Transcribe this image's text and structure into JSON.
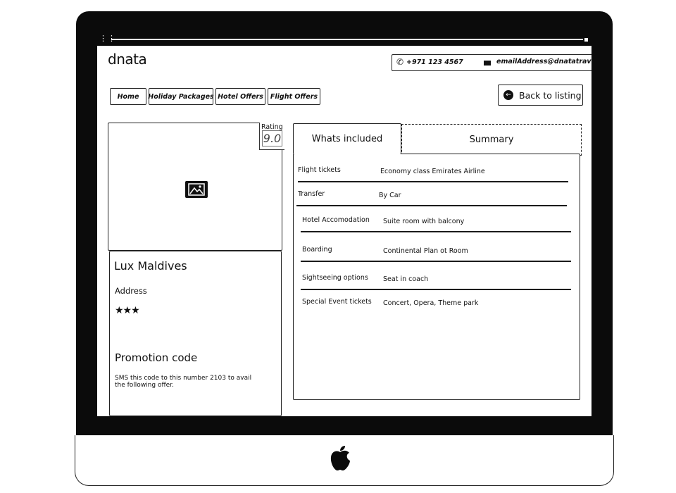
{
  "brand": {
    "logo": "dnata"
  },
  "contact": {
    "phone": "+971 123 4567",
    "email": "emailAddress@dnatatravel.com"
  },
  "nav": {
    "items": [
      {
        "label": "Home"
      },
      {
        "label": "Holiday Packages"
      },
      {
        "label": "Hotel Offers"
      },
      {
        "label": "Flight Offers"
      }
    ],
    "back_label": "Back to listing"
  },
  "hotel": {
    "rating_label": "Rating",
    "rating_value": "9.0",
    "name": "Lux Maldives",
    "address_label": "Address",
    "stars": "★★★",
    "star_count": 3
  },
  "promotion": {
    "title": "Promotion code",
    "text": "SMS this code to this number 2103 to avail the following offer."
  },
  "tabs": [
    {
      "label": "Whats included",
      "active": true
    },
    {
      "label": "Summary",
      "active": false
    }
  ],
  "included": [
    {
      "label": "Flight tickets",
      "value": "Economy class Emirates Airline"
    },
    {
      "label": "Transfer",
      "value": "By Car"
    },
    {
      "label": "Hotel Accomodation",
      "value": "Suite room with balcony"
    },
    {
      "label": "Boarding",
      "value": "Continental Plan ot Room"
    },
    {
      "label": "Sightseeing options",
      "value": "Seat in coach"
    },
    {
      "label": "Special Event tickets",
      "value": "Concert, Opera, Theme park"
    }
  ],
  "icons": {
    "phone": "phone-icon",
    "email": "mail-icon",
    "back": "arrow-left-icon",
    "image": "image-placeholder-icon",
    "device": "apple-logo-icon"
  },
  "colors": {
    "ink": "#111111",
    "background": "#ffffff",
    "bezel": "#0b0b0b"
  }
}
